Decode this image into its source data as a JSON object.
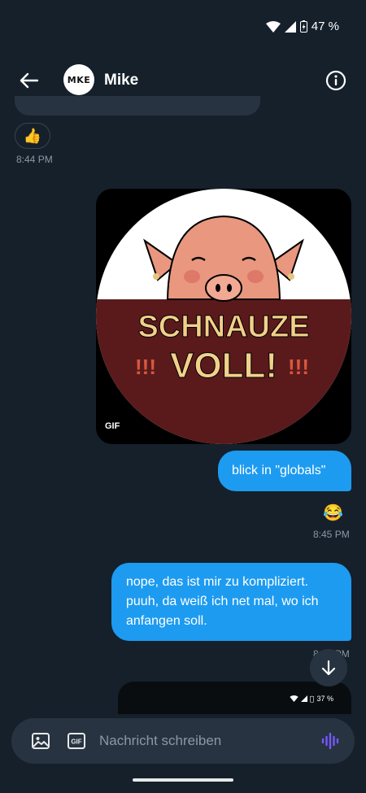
{
  "status_bar": {
    "battery": "47 %"
  },
  "header": {
    "avatar_text": "MKE",
    "contact_name": "Mike"
  },
  "messages": {
    "reaction_emoji": "👍",
    "time_1": "8:44 PM",
    "gif_text_line1": "SCHNAUZE",
    "gif_text_line2": "VOLL!",
    "gif_badge": "GIF",
    "bubble_1": "blick in \"globals\"",
    "emoji_reply": "😂",
    "time_2": "8:45 PM",
    "bubble_2_line1": "nope, das ist mir zu kompliziert.",
    "bubble_2_line2": "puuh, da weiß ich net mal, wo ich",
    "bubble_2_line3": "anfangen soll.",
    "time_3_partial": "8:45 PM",
    "nested_battery": "37 %"
  },
  "composer": {
    "gif_label": "GIF",
    "placeholder": "Nachricht schreiben"
  },
  "colors": {
    "background": "#15202b",
    "bubble": "#1d9bf0",
    "surface": "#273340",
    "voice": "#7856ff"
  }
}
